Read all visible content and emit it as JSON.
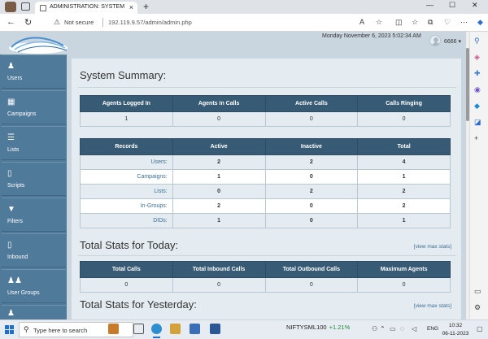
{
  "browser": {
    "tab_title": "ADMINISTRATION: SYSTEM SUMMARY",
    "tab_close": "×",
    "new_tab": "+",
    "minimize": "—",
    "maximize": "☐",
    "close": "✕",
    "security_label": "Not secure",
    "url": "192.119.9.57/admin/admin.php"
  },
  "header": {
    "datetime": "Monday November 6, 2023 5:02:34 AM",
    "username": "6666"
  },
  "nav": [
    {
      "label": "Users",
      "icon": "user-icon"
    },
    {
      "label": "Campaigns",
      "icon": "grid-icon"
    },
    {
      "label": "Lists",
      "icon": "list-icon"
    },
    {
      "label": "Scripts",
      "icon": "document-icon"
    },
    {
      "label": "Filters",
      "icon": "filter-icon"
    },
    {
      "label": "Inbound",
      "icon": "document-icon"
    },
    {
      "label": "User Groups",
      "icon": "users-icon"
    }
  ],
  "summary": {
    "title": "System Summary:",
    "agents_headers": [
      "Agents Logged In",
      "Agents In Calls",
      "Active Calls",
      "Calls Ringing"
    ],
    "agents_values": [
      "1",
      "0",
      "0",
      "0"
    ],
    "records_headers": [
      "Records",
      "Active",
      "Inactive",
      "Total"
    ],
    "records_rows": [
      {
        "name": "Users:",
        "active": "2",
        "inactive": "2",
        "total": "4"
      },
      {
        "name": "Campaigns:",
        "active": "1",
        "inactive": "0",
        "total": "1"
      },
      {
        "name": "Lists:",
        "active": "0",
        "inactive": "2",
        "total": "2"
      },
      {
        "name": "In-Groups:",
        "active": "2",
        "inactive": "0",
        "total": "2"
      },
      {
        "name": "DIDs:",
        "active": "1",
        "inactive": "0",
        "total": "1"
      }
    ]
  },
  "today": {
    "title": "Total Stats for Today:",
    "max_link": "[view max stats]",
    "headers": [
      "Total Calls",
      "Total Inbound Calls",
      "Total Outbound Calls",
      "Maximum Agents"
    ],
    "values": [
      "0",
      "0",
      "0",
      "0"
    ]
  },
  "yesterday": {
    "title": "Total Stats for Yesterday:",
    "max_link": "[view max stats]"
  },
  "taskbar": {
    "search_placeholder": "Type here to search",
    "stock_name": "NIFTYSML100",
    "stock_change": "+1.21%",
    "language": "ENG",
    "time": "10:32",
    "date": "06-11-2023"
  },
  "colors": {
    "nav_bg": "#507a9a",
    "table_header": "#375a75",
    "page_bg": "#c9d6df",
    "content_bg": "#e4ecf1"
  }
}
